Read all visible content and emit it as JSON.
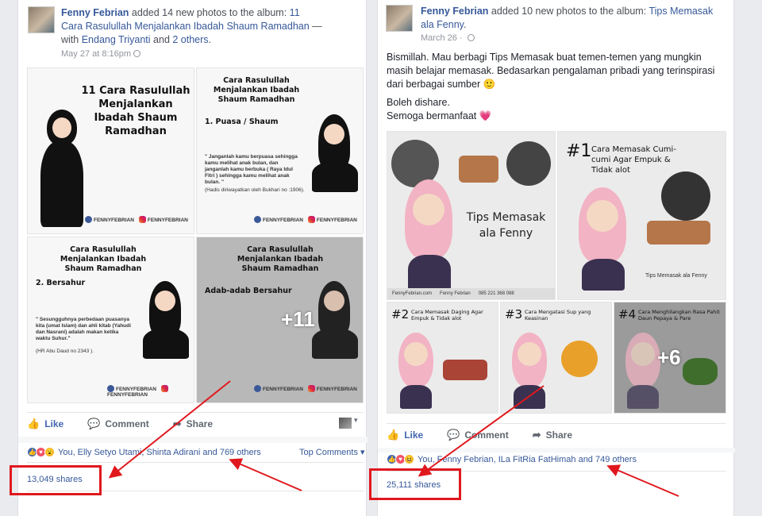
{
  "post1": {
    "author": "Fenny Febrian",
    "action_text": " added 14 new photos to the album: ",
    "album": "11 Cara Rasulullah Menjalankan Ibadah Shaum Ramadhan",
    "with_prefix": " — with ",
    "tagged": "Endang Triyanti",
    "and_text": " and ",
    "others": "2 others",
    "period": ".",
    "date": "May 27 at 8:16pm",
    "images": [
      {
        "title": "11 Cara Rasulullah Menjalankan Ibadah Shaum Ramadhan"
      },
      {
        "title": "Cara Rasulullah Menjalankan Ibadah Shaum Ramadhan",
        "subtitle": "1. Puasa / Shaum",
        "caption": "\" Janganlah kamu berpuasa sehingga kamu melihat anak bulan, dan janganlah kamu berbuka ( Raya Idul Fitri ) sehingga kamu melihat anak bulan. \"",
        "source": "(Hadis diriwayatkan oleh Bukhari no :1906)."
      },
      {
        "title": "Cara Rasulullah Menjalankan Ibadah Shaum Ramadhan",
        "subtitle": "2. Bersahur",
        "caption": "\" Sesungguhnya perbedaan puasanya kita (umat Islam) dan ahli kitab (Yahudi dan Nasrani) adalah makan ketika waktu Suhur.\"",
        "source": "(HR Abu Daud no 2343 )."
      },
      {
        "title": "Cara Rasulullah Menjalankan Ibadah Shaum Ramadhan",
        "subtitle": "Adab-adab Bersahur",
        "more": "+11"
      }
    ],
    "brand_fb": "FENNYFEBRIAN",
    "brand_ig": "FENNYFEBRIAN",
    "actions": {
      "like": "Like",
      "comment": "Comment",
      "share": "Share"
    },
    "reactions_text": "You, Elly Setyo Utami, Shinta Adirani and 769 others",
    "top_comments": "Top Comments",
    "shares": "13,049 shares"
  },
  "post2": {
    "author": "Fenny Febrian",
    "action_text": " added 10 new photos to the album: ",
    "album": "Tips Memasak ala Fenny",
    "period": ".",
    "date": "March 26",
    "body_line1": "Bismillah. Mau berbagi Tips Memasak buat temen-temen yang mungkin masih belajar memasak. Bedasarkan pengalaman pribadi yang terinspirasi dari berbagai sumber 🙂",
    "body_line2": "Boleh dishare.",
    "body_line3": "Semoga bermanfaat 💗",
    "images": [
      {
        "title": "Tips Memasak ala Fenny",
        "footer_fb": "FennyFebrian.com",
        "footer_name": "Fenny Febrian",
        "footer_phone": "085 221 368 088"
      },
      {
        "num": "#1",
        "title": "Cara Memasak Cumi-cumi Agar Empuk & Tidak alot",
        "footer": "Tips Memasak ala Fenny"
      },
      {
        "num": "#2",
        "title": "Cara Memasak Daging Agar Empuk & Tidak alot"
      },
      {
        "num": "#3",
        "title": "Cara Mengatasi Sup yang Keasinan"
      },
      {
        "num": "#4",
        "title": "Cara Menghilangkan Rasa Pahit Daun Pepaya & Pare",
        "more": "+6"
      }
    ],
    "actions": {
      "like": "Like",
      "comment": "Comment",
      "share": "Share"
    },
    "reactions_text": "You, Fenny Febrian, ILa FitRia FatHimah and 749 others",
    "shares": "25,111 shares"
  },
  "colors": {
    "highlight": "#e0181e",
    "fb_blue": "#365899",
    "like_blue": "#4267b2"
  }
}
